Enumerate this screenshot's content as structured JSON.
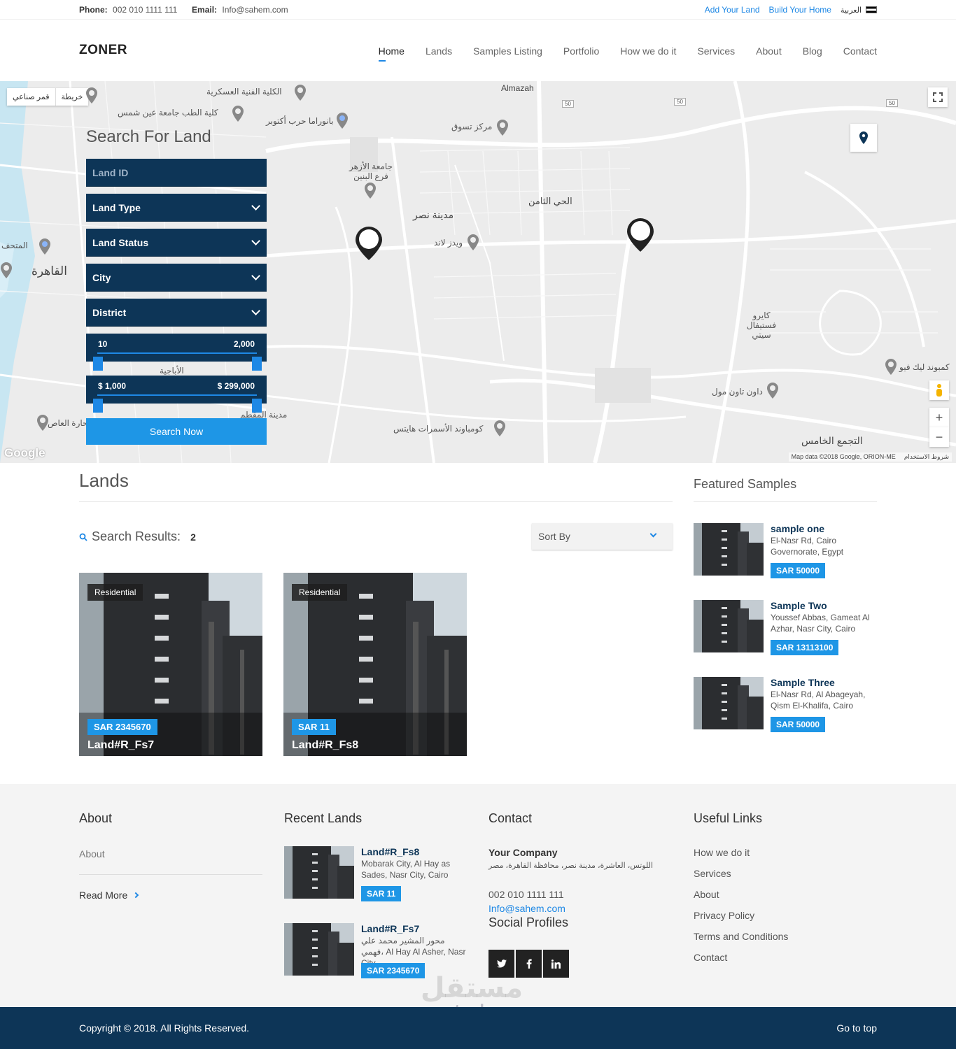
{
  "topbar": {
    "phone_label": "Phone:",
    "phone": "002 010 1111 111",
    "email_label": "Email:",
    "email": "Info@sahem.com",
    "links": [
      "Add Your Land",
      "Build Your Home"
    ],
    "language": "العربية"
  },
  "header": {
    "logo": "ZONER",
    "nav": [
      "Home",
      "Lands",
      "Samples Listing",
      "Portfolio",
      "How we do it",
      "Services",
      "About",
      "Blog",
      "Contact"
    ],
    "active_nav": "Home"
  },
  "map": {
    "type_buttons": [
      "خريطة",
      "قمر صناعي"
    ],
    "labels": [
      "Almazah",
      "مدينة نصر",
      "الحي الثامن",
      "القاهرة",
      "التجمع الخامس",
      "الكلية الفنية العسكرية",
      "كلية الطب جامعة عين شمس",
      "بانوراما حرب أكتوبر",
      "مركز تسوق",
      "جامعة الأزهر فرع البنين",
      "ويدز لاند",
      "كايرو فستيفال سيتي",
      "داون تاون مول",
      "كمبوند ليك فيو",
      "كومباوند الأسمرات هايتس",
      "مدينة المقطم",
      "الأباجية",
      "المتحف",
      "حارة العاص"
    ],
    "road_badges": [
      "50",
      "50",
      "50"
    ],
    "google": "Google",
    "attribution": "Map data ©2018 Google, ORION-ME",
    "terms": "شروط الاستخدام",
    "zoom_in": "+",
    "zoom_out": "−"
  },
  "search": {
    "title": "Search For Land",
    "land_id_placeholder": "Land ID",
    "land_type": "Land Type",
    "land_status": "Land Status",
    "city": "City",
    "district": "District",
    "area_min": "10",
    "area_max": "2,000",
    "price_min": "$ 1,000",
    "price_max": "$ 299,000",
    "button": "Search Now"
  },
  "lands": {
    "title": "Lands",
    "results_label": "Search Results:",
    "results_count": "2",
    "sort_label": "Sort By",
    "cards": [
      {
        "tag": "Residential",
        "price": "SAR 2345670",
        "title": "Land#R_Fs7"
      },
      {
        "tag": "Residential",
        "price": "SAR 11",
        "title": "Land#R_Fs8"
      }
    ]
  },
  "featured": {
    "title": "Featured Samples",
    "items": [
      {
        "name": "sample one",
        "addr": "El-Nasr Rd, Cairo Governorate, Egypt",
        "price": "SAR 50000"
      },
      {
        "name": "Sample Two",
        "addr": "Youssef Abbas, Gameat Al Azhar, Nasr City, Cairo",
        "price": "SAR 13113100"
      },
      {
        "name": "Sample Three",
        "addr": "El-Nasr Rd, Al Abageyah, Qism El-Khalifa, Cairo",
        "price": "SAR 50000"
      }
    ]
  },
  "footer": {
    "about_title": "About",
    "about_text": "About",
    "read_more": "Read More",
    "recent_title": "Recent Lands",
    "recent": [
      {
        "name": "Land#R_Fs8",
        "addr": "Mobarak City, Al Hay as Sades, Nasr City, Cairo",
        "price": "SAR 11"
      },
      {
        "name": "Land#R_Fs7",
        "addr": "محور المشير محمد علي فهمي، Al Hay Al Asher, Nasr City,",
        "price": "SAR 2345670"
      }
    ],
    "contact_title": "Contact",
    "company": "Your Company",
    "address": "اللوتس، العاشرة، مدينة نصر، محافظة القاهرة، مصر",
    "phone": "002 010 1111 111",
    "email": "Info@sahem.com",
    "social_title": "Social Profiles",
    "social": [
      "twitter-icon",
      "facebook-icon",
      "linkedin-icon"
    ],
    "useful_title": "Useful Links",
    "useful": [
      "How we do it",
      "Services",
      "About",
      "Privacy Policy",
      "Terms and Conditions",
      "Contact"
    ]
  },
  "watermark": {
    "ar": "مستقل",
    "en": "mostaql.com"
  },
  "bottom": {
    "copyright": "Copyright © 2018. All Rights Reserved.",
    "to_top": "Go to top"
  },
  "colors": {
    "navy": "#0d3557",
    "accent": "#1e96e6",
    "link": "#1e88e5"
  }
}
